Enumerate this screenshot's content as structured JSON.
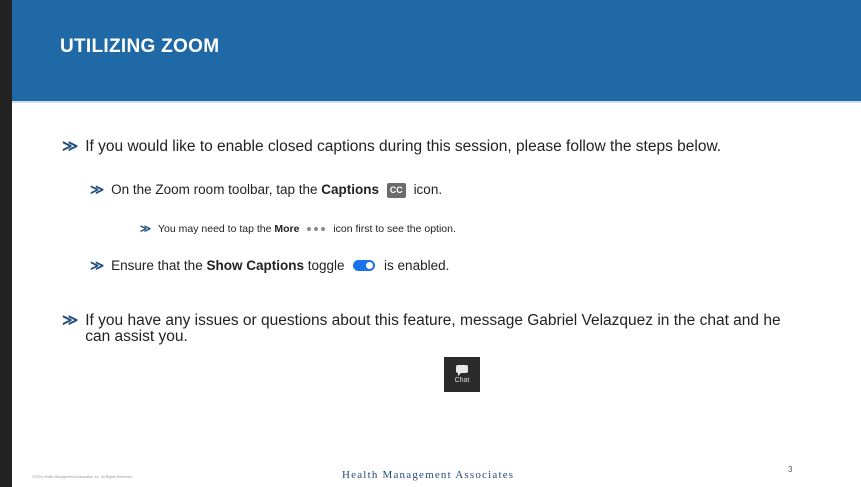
{
  "slide": {
    "title": "UTILIZING ZOOM",
    "bullet_glyph": "≫",
    "bullets": [
      {
        "text": "If you would like to enable closed captions during this session, please follow the steps below."
      },
      {
        "pre": "On the Zoom room toolbar, tap the ",
        "bold": "Captions",
        "badge": "CC",
        "post": "icon."
      },
      {
        "pre": "You may need to tap the ",
        "bold": "More",
        "post": "icon first to see the option."
      },
      {
        "pre": "Ensure that the ",
        "bold": "Show Captions",
        "mid": "toggle",
        "post": "is enabled."
      },
      {
        "text": "If you have any issues or questions about this feature, message Gabriel Velazquez in the chat and he can assist you."
      }
    ],
    "chat_button": {
      "label": "Chat",
      "icon": "chat-bubble-icon"
    },
    "footer": {
      "copyright": "©2024 Health Management Associates, Inc. All Rights Reserved.",
      "logo": "Health Management Associates",
      "page_number": "3"
    }
  },
  "colors": {
    "header": "#1f6aa6",
    "toggle": "#1a73e8",
    "cc_badge": "#6b6b6b"
  }
}
